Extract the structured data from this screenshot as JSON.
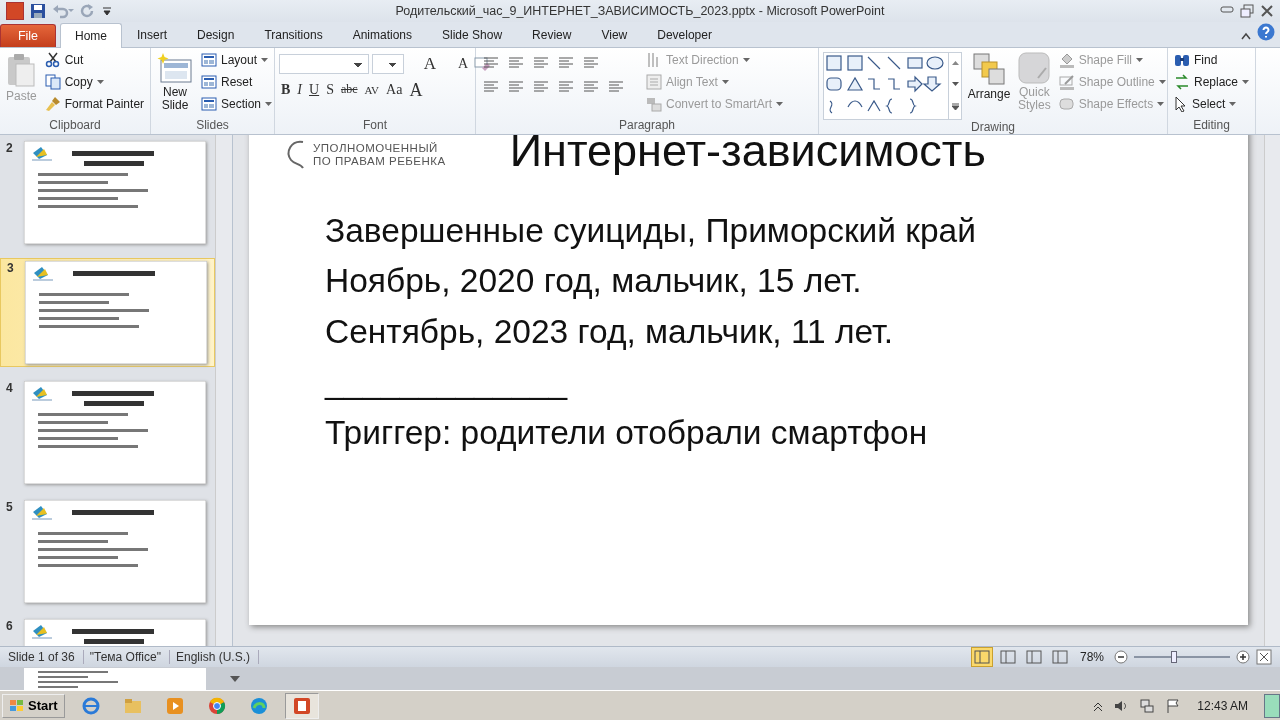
{
  "window": {
    "title": "Родительский_час_9_ИНТЕРНЕТ_ЗАВИСИМОСТЬ_2023.pptx  -  Microsoft PowerPoint"
  },
  "tabs": [
    {
      "label": "File",
      "kind": "file",
      "selected": false
    },
    {
      "label": "Home",
      "kind": "tab",
      "selected": true
    },
    {
      "label": "Insert",
      "kind": "tab",
      "selected": false
    },
    {
      "label": "Design",
      "kind": "tab",
      "selected": false
    },
    {
      "label": "Transitions",
      "kind": "tab",
      "selected": false
    },
    {
      "label": "Animations",
      "kind": "tab",
      "selected": false
    },
    {
      "label": "Slide Show",
      "kind": "tab",
      "selected": false
    },
    {
      "label": "Review",
      "kind": "tab",
      "selected": false
    },
    {
      "label": "View",
      "kind": "tab",
      "selected": false
    },
    {
      "label": "Developer",
      "kind": "tab",
      "selected": false
    }
  ],
  "ribbon": {
    "groups": [
      {
        "label": "Clipboard",
        "kind": "clipboard",
        "items": [
          {
            "label": "Paste",
            "disabled": true
          },
          {
            "label": "Cut",
            "disabled": false
          },
          {
            "label": "Copy",
            "disabled": false
          },
          {
            "label": "Format Painter",
            "disabled": false
          }
        ]
      },
      {
        "label": "Slides",
        "kind": "slides",
        "items": [
          {
            "label": "New Slide",
            "disabled": false
          },
          {
            "label": "Layout",
            "disabled": false
          },
          {
            "label": "Reset",
            "disabled": false
          },
          {
            "label": "Section",
            "disabled": false
          }
        ]
      },
      {
        "label": "Font",
        "kind": "font",
        "items": [
          {
            "label": "A",
            "disabled": false
          },
          {
            "label": "A",
            "disabled": false
          },
          {
            "label": "B",
            "disabled": false
          },
          {
            "label": "I",
            "disabled": false
          },
          {
            "label": "U",
            "disabled": false
          },
          {
            "label": "S",
            "disabled": false
          },
          {
            "label": "abc",
            "disabled": false
          },
          {
            "label": "AV",
            "disabled": false
          },
          {
            "label": "Aa",
            "disabled": false
          },
          {
            "label": "A",
            "disabled": false
          }
        ]
      },
      {
        "label": "Paragraph",
        "kind": "paragraph",
        "items": [
          {
            "label": "Text Direction",
            "disabled": true
          },
          {
            "label": "Align Text",
            "disabled": true
          },
          {
            "label": "Convert to SmartArt",
            "disabled": true
          }
        ]
      },
      {
        "label": "Drawing",
        "kind": "drawing",
        "items": [
          {
            "label": "Arrange",
            "disabled": false
          },
          {
            "label": "Quick Styles",
            "disabled": true
          },
          {
            "label": "Shape Fill",
            "disabled": true
          },
          {
            "label": "Shape Outline",
            "disabled": true
          },
          {
            "label": "Shape Effects",
            "disabled": true
          }
        ]
      },
      {
        "label": "Editing",
        "kind": "editing",
        "items": [
          {
            "label": "Find",
            "disabled": false
          },
          {
            "label": "Replace",
            "disabled": false
          },
          {
            "label": "Select",
            "disabled": false
          }
        ]
      }
    ]
  },
  "thumbnails": [
    {
      "number": "2",
      "selected": false
    },
    {
      "number": "3",
      "selected": true
    },
    {
      "number": "4",
      "selected": false
    },
    {
      "number": "5",
      "selected": false
    },
    {
      "number": "6",
      "selected": false
    }
  ],
  "slide": {
    "logo_lines": [
      "УПОЛНОМОЧЕННЫЙ",
      "ПО ПРАВАМ РЕБЕНКА"
    ],
    "title": "Интернет-зависимость",
    "lines": [
      "Завершенные суициды, Приморский край",
      "Ноябрь, 2020 год, мальчик, 15 лет.",
      "Сентябрь, 2023 год, мальчик, 11 лет.",
      "_____________",
      "Триггер: родители отобрали смартфон"
    ]
  },
  "status_bar": {
    "slide": "Slide 1 of 36",
    "theme": "\"Тема Office\"",
    "language": "English (U.S.)",
    "views": [
      {
        "selected": true
      },
      {
        "selected": false
      },
      {
        "selected": false
      },
      {
        "selected": false
      }
    ],
    "zoom": "78%",
    "level": 0.42
  },
  "taskbar": {
    "start": "Start",
    "apps": [
      {
        "selected": false
      },
      {
        "selected": false
      },
      {
        "selected": false
      },
      {
        "selected": false
      },
      {
        "selected": false
      },
      {
        "selected": true
      }
    ],
    "clock": "12:43 AM"
  }
}
